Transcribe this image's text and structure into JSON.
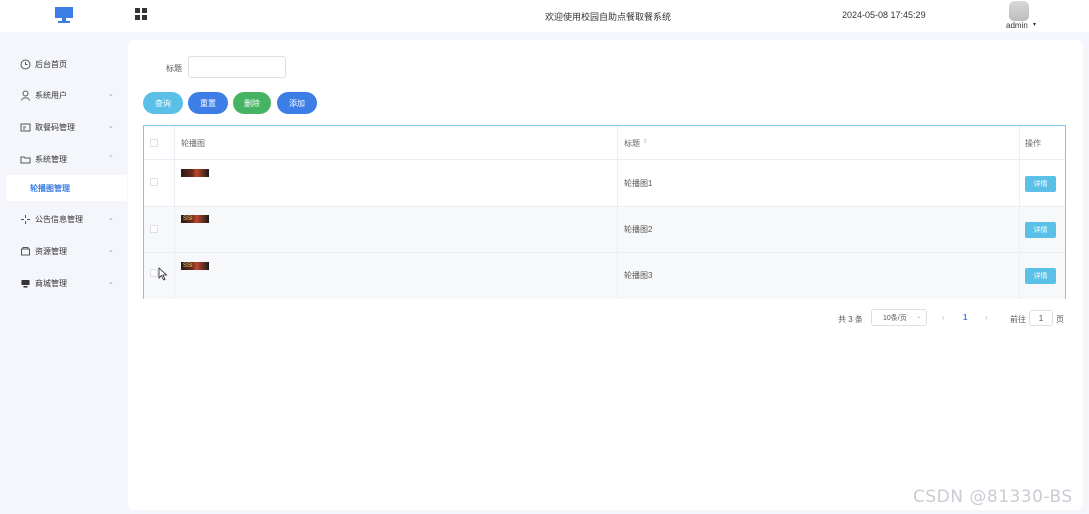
{
  "header": {
    "title": "欢迎使用校园自助点餐取餐系统",
    "datetime": "2024-05-08 17:45:29",
    "user": "admin",
    "caret": "▾"
  },
  "sidebar": {
    "items": [
      {
        "label": "后台首页",
        "icon": "clock-icon"
      },
      {
        "label": "系统用户",
        "icon": "user-icon",
        "chevron": "⌄"
      },
      {
        "label": "取餐码管理",
        "icon": "card-icon",
        "chevron": "⌄"
      },
      {
        "label": "系统管理",
        "icon": "folder-icon",
        "chevron": "⌃"
      },
      {
        "label": "公告信息管理",
        "icon": "sparkle-icon",
        "chevron": "⌄"
      },
      {
        "label": "资源管理",
        "icon": "box-icon",
        "chevron": "⌄"
      },
      {
        "label": "商城管理",
        "icon": "monitor-icon",
        "chevron": "⌄"
      }
    ],
    "active_sub": "轮播图管理"
  },
  "search": {
    "label": "标题",
    "value": ""
  },
  "buttons": {
    "query": "查询",
    "reset": "重置",
    "delete": "删除",
    "add": "添加"
  },
  "table": {
    "headers": {
      "image": "轮播图",
      "title": "标题",
      "sort": "⇳",
      "action": "操作"
    },
    "rows": [
      {
        "thumb_text": "",
        "title": "轮播图1",
        "action": "详情"
      },
      {
        "thumb_text": "SSI",
        "title": "轮播图2",
        "action": "详情"
      },
      {
        "thumb_text": "SSI",
        "title": "轮播图3",
        "action": "详情"
      }
    ]
  },
  "pagination": {
    "total": "共 3 条",
    "page_size": "10条/页",
    "dropdown": "⌄",
    "prev": "‹",
    "current_page": "1",
    "next": "›",
    "goto_label": "前往",
    "goto_value": "1",
    "page_unit": "页"
  },
  "watermark": "CSDN @81330-BS",
  "colors": {
    "primary": "#3c7ee6",
    "info": "#5bc0e8",
    "success": "#46b363",
    "background": "#f4f6fb"
  }
}
